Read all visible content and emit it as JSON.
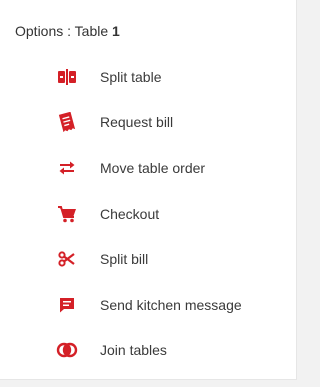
{
  "header": {
    "prefix": "Options : Table ",
    "table_number": "1"
  },
  "accent_color": "#d42027",
  "menu": {
    "items": [
      {
        "label": "Split table",
        "icon": "split-table-icon"
      },
      {
        "label": "Request bill",
        "icon": "receipt-icon"
      },
      {
        "label": "Move table order",
        "icon": "swap-arrows-icon"
      },
      {
        "label": "Checkout",
        "icon": "shopping-cart-icon"
      },
      {
        "label": "Split bill",
        "icon": "scissors-icon"
      },
      {
        "label": "Send kitchen message",
        "icon": "message-icon"
      },
      {
        "label": "Join tables",
        "icon": "join-circles-icon"
      }
    ]
  }
}
